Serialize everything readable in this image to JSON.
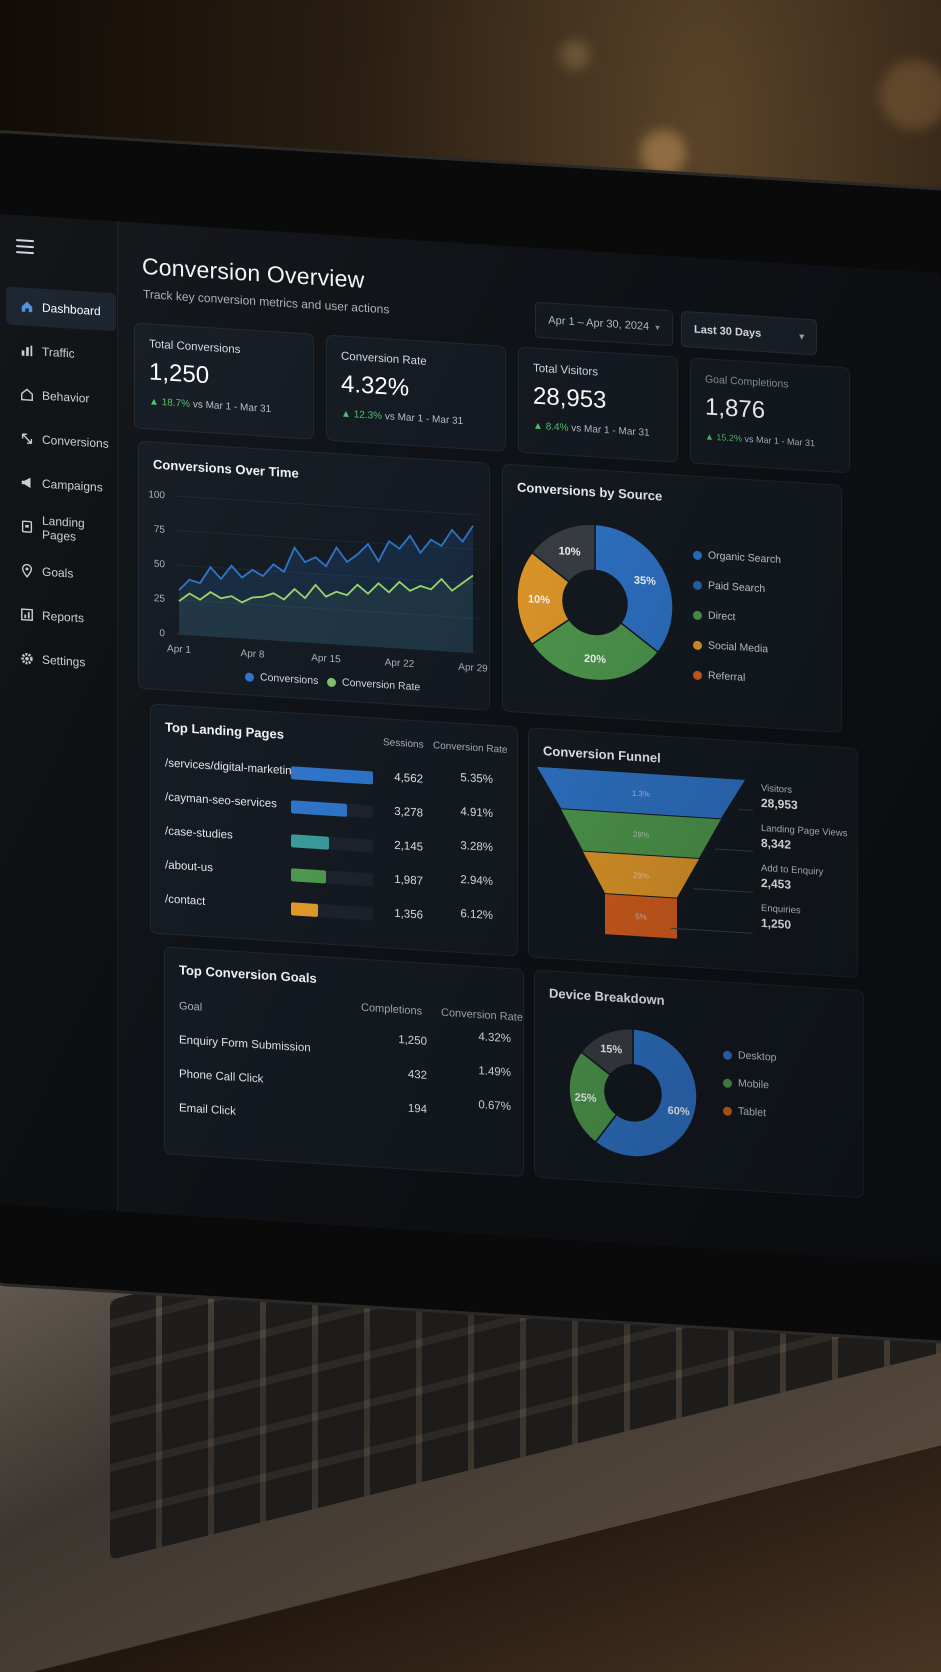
{
  "sidebar": {
    "items": [
      {
        "label": "Dashboard",
        "icon": "home-icon",
        "active": true
      },
      {
        "label": "Traffic",
        "icon": "traffic-icon"
      },
      {
        "label": "Behavior",
        "icon": "behavior-icon"
      },
      {
        "label": "Conversions",
        "icon": "conversions-icon"
      },
      {
        "label": "Campaigns",
        "icon": "megaphone-icon"
      },
      {
        "label": "Landing Pages",
        "icon": "page-icon"
      },
      {
        "label": "Goals",
        "icon": "location-pin-icon"
      },
      {
        "label": "Reports",
        "icon": "reports-icon"
      },
      {
        "label": "Settings",
        "icon": "gear-icon"
      }
    ]
  },
  "header": {
    "title": "Conversion Overview",
    "subtitle": "Track key conversion metrics and user actions",
    "date_range": "Apr 1 – Apr 30, 2024",
    "period": "Last 30 Days"
  },
  "kpis": [
    {
      "label": "Total Conversions",
      "value": "1,250",
      "delta": "18.7%",
      "compare": "vs Mar 1 - Mar 31"
    },
    {
      "label": "Conversion Rate",
      "value": "4.32%",
      "delta": "12.3%",
      "compare": "vs Mar 1 - Mar 31"
    },
    {
      "label": "Total Visitors",
      "value": "28,953",
      "delta": "8.4%",
      "compare": "vs Mar 1 - Mar 31"
    },
    {
      "label": "Goal Completions",
      "value": "1,876",
      "delta": "15.2%",
      "compare": "vs Mar 1 - Mar 31"
    }
  ],
  "colors": {
    "blue": "#2f74c8",
    "green": "#4f9a4f",
    "orange": "#e39a2a",
    "red_orange": "#d9601f",
    "gray": "#3a3f44",
    "teal": "#3a9a9a",
    "line_green": "#9bd468"
  },
  "chart_data": [
    {
      "type": "line",
      "title": "Conversions Over Time",
      "x_ticks": [
        "Apr 1",
        "Apr 8",
        "Apr 15",
        "Apr 22",
        "Apr 29"
      ],
      "ylim": [
        0,
        100
      ],
      "y_ticks": [
        0,
        25,
        50,
        75,
        100
      ],
      "grid": true,
      "legend_position": "bottom",
      "series": [
        {
          "name": "Conversions",
          "values": [
            32,
            40,
            38,
            50,
            42,
            52,
            44,
            50,
            46,
            55,
            50,
            68,
            58,
            62,
            56,
            70,
            60,
            66,
            74,
            62,
            77,
            72,
            82,
            70,
            80,
            76,
            88,
            80,
            92
          ]
        },
        {
          "name": "Conversion Rate",
          "values": [
            24,
            30,
            26,
            32,
            28,
            30,
            26,
            30,
            31,
            34,
            30,
            38,
            32,
            42,
            34,
            38,
            36,
            44,
            38,
            46,
            40,
            48,
            42,
            46,
            44,
            52,
            44,
            50,
            56
          ]
        }
      ]
    },
    {
      "type": "pie",
      "title": "Conversions by Source",
      "legend_position": "right",
      "categories": [
        "Organic Search",
        "Paid Search",
        "Direct",
        "Social Media",
        "Referral"
      ],
      "slice_labels": [
        "35%",
        "20%",
        "10%",
        "10%"
      ],
      "slices": [
        {
          "value": 35,
          "color_key": "blue",
          "label": "35%"
        },
        {
          "value": 30,
          "color_key": "green",
          "label": "20%"
        },
        {
          "value": 20,
          "color_key": "orange",
          "label": "10%"
        },
        {
          "value": 15,
          "color_key": "gray",
          "label": "10%"
        }
      ]
    },
    {
      "type": "table",
      "title": "Top Landing Pages",
      "columns": [
        "Sessions",
        "Conversion Rate"
      ],
      "rows": [
        {
          "page": "/services/digital-marketing",
          "sessions": "4,562",
          "rate": "5.35%",
          "bar": 1.0,
          "color_key": "blue"
        },
        {
          "page": "/cayman-seo-services",
          "sessions": "3,278",
          "rate": "4.91%",
          "bar": 0.68,
          "color_key": "blue"
        },
        {
          "page": "/case-studies",
          "sessions": "2,145",
          "rate": "3.28%",
          "bar": 0.46,
          "color_key": "teal"
        },
        {
          "page": "/about-us",
          "sessions": "1,987",
          "rate": "2.94%",
          "bar": 0.43,
          "color_key": "green"
        },
        {
          "page": "/contact",
          "sessions": "1,356",
          "rate": "6.12%",
          "bar": 0.33,
          "color_key": "orange"
        }
      ]
    },
    {
      "type": "bar",
      "title": "Conversion Funnel",
      "stages": [
        {
          "label": "Visitors",
          "value": "28,953",
          "inner": "1.3%",
          "color_key": "blue"
        },
        {
          "label": "Landing Page Views",
          "value": "8,342",
          "inner": "28%",
          "color_key": "green"
        },
        {
          "label": "Add to Enquiry",
          "value": "2,453",
          "inner": "29%",
          "color_key": "orange"
        },
        {
          "label": "Enquiries",
          "value": "1,250",
          "inner": "5%",
          "color_key": "red_orange"
        }
      ]
    },
    {
      "type": "table",
      "title": "Top Conversion Goals",
      "columns": [
        "Goal",
        "Completions",
        "Conversion Rate"
      ],
      "rows": [
        {
          "goal": "Enquiry Form Submission",
          "completions": "1,250",
          "rate": "4.32%"
        },
        {
          "goal": "Phone Call Click",
          "completions": "432",
          "rate": "1.49%"
        },
        {
          "goal": "Email Click",
          "completions": "194",
          "rate": "0.67%"
        }
      ]
    },
    {
      "type": "pie",
      "title": "Device Breakdown",
      "legend_position": "right",
      "categories": [
        "Desktop",
        "Mobile",
        "Tablet"
      ],
      "slices": [
        {
          "value": 60,
          "color_key": "blue",
          "label": "60%"
        },
        {
          "value": 25,
          "color_key": "green",
          "label": "25%"
        },
        {
          "value": 15,
          "color_key": "gray",
          "label": "15%"
        }
      ]
    }
  ]
}
